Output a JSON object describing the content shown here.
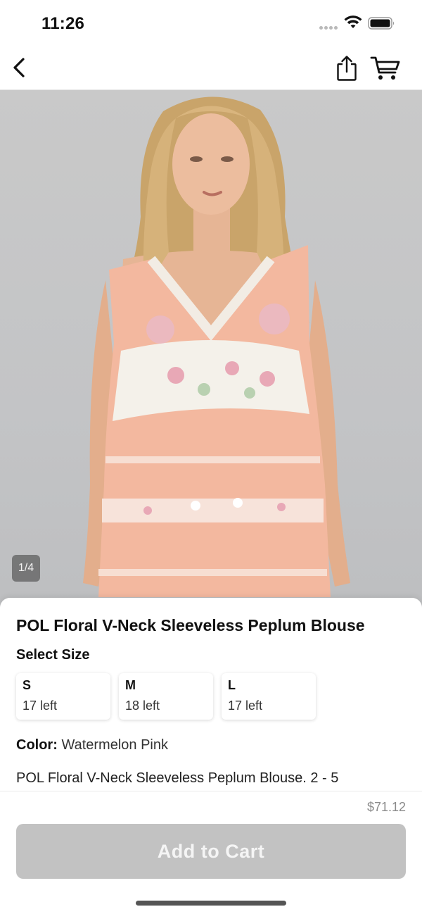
{
  "status_bar": {
    "time": "11:26",
    "icons": [
      "signal-dots-icon",
      "wifi-icon",
      "battery-icon"
    ]
  },
  "nav": {
    "icons": [
      "back-icon",
      "share-icon",
      "cart-icon"
    ]
  },
  "gallery": {
    "counter": "1/4",
    "image_subject": "model wearing peach floral sleeveless v-neck peplum blouse",
    "colors": {
      "background": "#c6c7c9",
      "garment": "#f5bfa4",
      "floral": "#f4f1ea"
    }
  },
  "product": {
    "title": "POL Floral V-Neck Sleeveless Peplum Blouse",
    "select_size_label": "Select Size",
    "sizes": [
      {
        "name": "S",
        "stock": "17 left"
      },
      {
        "name": "M",
        "stock": "18 left"
      },
      {
        "name": "L",
        "stock": "17 left"
      }
    ],
    "color_label": "Color:",
    "color_value": "Watermelon Pink",
    "description": "POL Floral V-Neck Sleeveless Peplum Blouse. 2 - 5"
  },
  "footer": {
    "price": "$71.12",
    "add_to_cart_label": "Add to Cart",
    "button_color": "#c2c2c2"
  }
}
